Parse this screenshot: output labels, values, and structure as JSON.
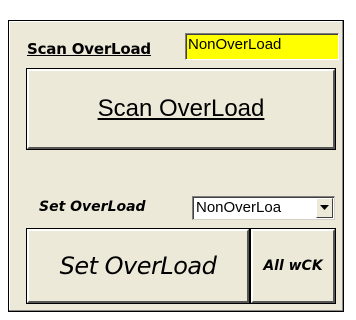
{
  "scan": {
    "label": "Scan OverLoad",
    "status_value": "NonOverLoad",
    "status_color": "#ffff00",
    "button_label": "Scan OverLoad"
  },
  "set": {
    "label": "Set OverLoad",
    "selected_value": "NonOverLoa",
    "button_label": "Set OverLoad",
    "all_button_label": "All wCK"
  },
  "icons": {
    "dropdown": "chevron-down-icon"
  }
}
